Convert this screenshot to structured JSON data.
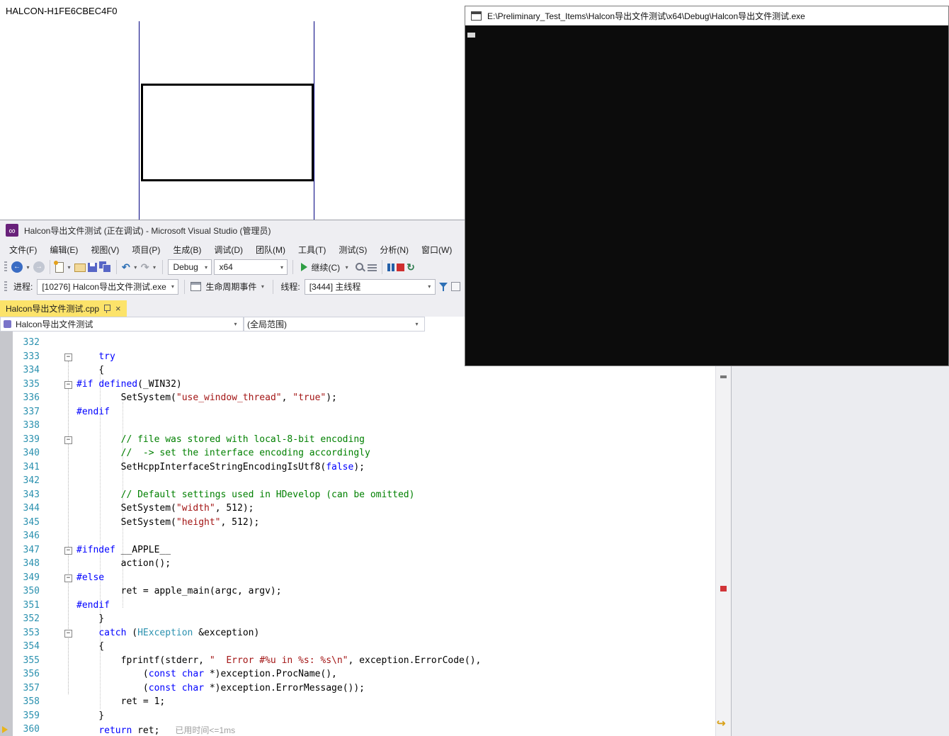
{
  "halcon": {
    "title": "HALCON-H1FE6CBEC4F0"
  },
  "console": {
    "title": "E:\\Preliminary_Test_Items\\Halcon导出文件测试\\x64\\Debug\\Halcon导出文件测试.exe"
  },
  "vs": {
    "title": "Halcon导出文件测试 (正在调试) - Microsoft Visual Studio (管理员)",
    "menus": [
      "文件(F)",
      "编辑(E)",
      "视图(V)",
      "项目(P)",
      "生成(B)",
      "调试(D)",
      "团队(M)",
      "工具(T)",
      "测试(S)",
      "分析(N)",
      "窗口(W)"
    ],
    "toolbar": {
      "config": "Debug",
      "platform": "x64",
      "continue_label": "继续(C)"
    },
    "debugbar": {
      "process_label": "进程:",
      "process_value": "[10276] Halcon导出文件测试.exe",
      "lifecycle_label": "生命周期事件",
      "thread_label": "线程:",
      "thread_value": "[3444] 主线程"
    },
    "tab": "Halcon导出文件测试.cpp",
    "navbar": {
      "scope": "Halcon导出文件测试",
      "member": "(全局范围)"
    },
    "editor": {
      "perf_tip": "已用时间<=1ms",
      "lines": [
        {
          "n": 332,
          "seg": []
        },
        {
          "n": 333,
          "fold": true,
          "seg": [
            [
              "d",
              "    "
            ],
            [
              "k",
              "try"
            ]
          ]
        },
        {
          "n": 334,
          "seg": [
            [
              "d",
              "    {"
            ]
          ]
        },
        {
          "n": 335,
          "fold": true,
          "seg": [
            [
              "k",
              "#if"
            ],
            [
              "d",
              " "
            ],
            [
              "k",
              "defined"
            ],
            [
              "d",
              "(_WIN32)"
            ]
          ]
        },
        {
          "n": 336,
          "seg": [
            [
              "d",
              "        SetSystem("
            ],
            [
              "s",
              "\"use_window_thread\""
            ],
            [
              "d",
              ", "
            ],
            [
              "s",
              "\"true\""
            ],
            [
              "d",
              ");"
            ]
          ]
        },
        {
          "n": 337,
          "seg": [
            [
              "k",
              "#endif"
            ]
          ]
        },
        {
          "n": 338,
          "seg": []
        },
        {
          "n": 339,
          "fold": true,
          "seg": [
            [
              "c",
              "        // file was stored with local-8-bit encoding"
            ]
          ]
        },
        {
          "n": 340,
          "seg": [
            [
              "c",
              "        //  -> set the interface encoding accordingly"
            ]
          ]
        },
        {
          "n": 341,
          "seg": [
            [
              "d",
              "        SetHcppInterfaceStringEncodingIsUtf8("
            ],
            [
              "k",
              "false"
            ],
            [
              "d",
              ");"
            ]
          ]
        },
        {
          "n": 342,
          "seg": []
        },
        {
          "n": 343,
          "seg": [
            [
              "c",
              "        // Default settings used in HDevelop (can be omitted)"
            ]
          ]
        },
        {
          "n": 344,
          "seg": [
            [
              "d",
              "        SetSystem("
            ],
            [
              "s",
              "\"width\""
            ],
            [
              "d",
              ", 512);"
            ]
          ]
        },
        {
          "n": 345,
          "seg": [
            [
              "d",
              "        SetSystem("
            ],
            [
              "s",
              "\"height\""
            ],
            [
              "d",
              ", 512);"
            ]
          ]
        },
        {
          "n": 346,
          "seg": []
        },
        {
          "n": 347,
          "fold": true,
          "seg": [
            [
              "k",
              "#ifndef"
            ],
            [
              "d",
              " __APPLE__"
            ]
          ]
        },
        {
          "n": 348,
          "seg": [
            [
              "d",
              "        action();"
            ]
          ]
        },
        {
          "n": 349,
          "fold": true,
          "seg": [
            [
              "k",
              "#else"
            ]
          ]
        },
        {
          "n": 350,
          "seg": [
            [
              "d",
              "        ret = apple_main(argc, argv);"
            ]
          ]
        },
        {
          "n": 351,
          "seg": [
            [
              "k",
              "#endif"
            ]
          ]
        },
        {
          "n": 352,
          "seg": [
            [
              "d",
              "    }"
            ]
          ]
        },
        {
          "n": 353,
          "fold": true,
          "seg": [
            [
              "d",
              "    "
            ],
            [
              "k",
              "catch"
            ],
            [
              "d",
              " ("
            ],
            [
              "t",
              "HException"
            ],
            [
              "d",
              " &exception)"
            ]
          ]
        },
        {
          "n": 354,
          "seg": [
            [
              "d",
              "    {"
            ]
          ]
        },
        {
          "n": 355,
          "seg": [
            [
              "d",
              "        fprintf(stderr, "
            ],
            [
              "s",
              "\"  Error #%u in %s: %s\\n\""
            ],
            [
              "d",
              ", exception.ErrorCode(),"
            ]
          ]
        },
        {
          "n": 356,
          "seg": [
            [
              "d",
              "            ("
            ],
            [
              "k",
              "const"
            ],
            [
              "d",
              " "
            ],
            [
              "k",
              "char"
            ],
            [
              "d",
              " *)exception.ProcName(),"
            ]
          ]
        },
        {
          "n": 357,
          "seg": [
            [
              "d",
              "            ("
            ],
            [
              "k",
              "const"
            ],
            [
              "d",
              " "
            ],
            [
              "k",
              "char"
            ],
            [
              "d",
              " *)exception.ErrorMessage());"
            ]
          ]
        },
        {
          "n": 358,
          "seg": [
            [
              "d",
              "        ret = 1;"
            ]
          ]
        },
        {
          "n": 359,
          "seg": [
            [
              "d",
              "    }"
            ]
          ]
        },
        {
          "n": 360,
          "perf": true,
          "seg": [
            [
              "d",
              "    "
            ],
            [
              "k",
              "return"
            ],
            [
              "d",
              " ret;"
            ]
          ]
        }
      ]
    }
  },
  "icons": {
    "caret": "▾",
    "close": "×",
    "fold_collapse": "−",
    "undo": "↶",
    "redo": "↷",
    "back_arrow": "←",
    "forward_arrow": "→",
    "restart": "↻",
    "current_arrow": "↪",
    "vs_logo": "∞"
  },
  "colors": {
    "vs_chrome": "#eeeef2",
    "tab_active_yellow": "#fce36a",
    "keyword": "#0000ff",
    "string": "#a31515",
    "comment": "#008000",
    "type": "#2b91af",
    "line_number": "#2b91af",
    "halcon_region_line": "#000080",
    "console_background": "#0c0c0c"
  }
}
